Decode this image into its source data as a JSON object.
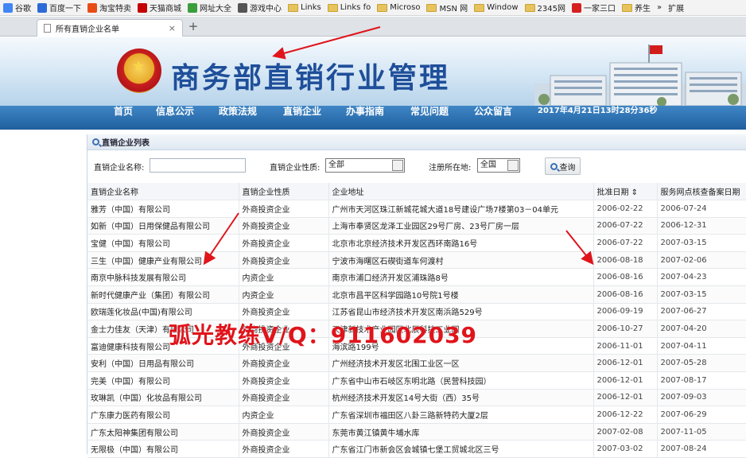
{
  "bookmarks": [
    {
      "label": "谷歌",
      "icon": "google-icon",
      "color": "#4285f4"
    },
    {
      "label": "百度一下",
      "icon": "baidu-icon",
      "color": "#2d6ad8"
    },
    {
      "label": "淘宝特卖",
      "icon": "taobao-icon",
      "color": "#e84c16"
    },
    {
      "label": "天猫商城",
      "icon": "tmall-icon",
      "color": "#c40000"
    },
    {
      "label": "网址大全",
      "icon": "globe-icon",
      "color": "#3a9e3a"
    },
    {
      "label": "游戏中心",
      "icon": "gamepad-icon",
      "color": "#555555"
    },
    {
      "label": "Links",
      "icon": "folder-icon"
    },
    {
      "label": "Links fo",
      "icon": "folder-icon"
    },
    {
      "label": "Microso",
      "icon": "folder-icon"
    },
    {
      "label": "MSN 网",
      "icon": "folder-icon"
    },
    {
      "label": "Window",
      "icon": "folder-icon"
    },
    {
      "label": "2345网",
      "icon": "folder-icon"
    },
    {
      "label": "一家三口",
      "icon": "jia-icon",
      "color": "#d62020"
    },
    {
      "label": "养生",
      "icon": "folder-icon"
    }
  ],
  "bookmarks_more": "»",
  "extension_label": "扩展",
  "tab": {
    "title": "所有直销企业名单",
    "close": "×",
    "new_tab": "+"
  },
  "site": {
    "title": "商务部直销行业管理"
  },
  "nav": {
    "items": [
      "首页",
      "信息公示",
      "政策法规",
      "直销企业",
      "办事指南",
      "常见问题",
      "公众留言"
    ],
    "date": "2017年4月21日13时28分36秒"
  },
  "panel": {
    "title": "直销企业列表"
  },
  "filters": {
    "name_label": "直销企业名称:",
    "type_label": "直销企业性质:",
    "type_value": "全部",
    "region_label": "注册所在地:",
    "region_value": "全国",
    "query_button": "查询"
  },
  "table": {
    "columns": [
      "直销企业名称",
      "直销企业性质",
      "企业地址",
      "批准日期 ⇕",
      "服务网点核查备案日期"
    ],
    "rows": [
      [
        "雅芳（中国）有限公司",
        "外商投资企业",
        "广州市天河区珠江新城花城大道18号建设广场7楼第03－04单元",
        "2006-02-22",
        "2006-07-24"
      ],
      [
        "如新（中国）日用保健品有限公司",
        "外商投资企业",
        "上海市奉贤区龙泽工业园区29号厂房、23号厂房一层",
        "2006-07-22",
        "2006-12-31"
      ],
      [
        "宝健（中国）有限公司",
        "外商投资企业",
        "北京市北京经济技术开发区西环南路16号",
        "2006-07-22",
        "2007-03-15"
      ],
      [
        "三生（中国）健康产业有限公司",
        "外商投资企业",
        "宁波市海曙区石碶街道车何渡村",
        "2006-08-18",
        "2007-02-06"
      ],
      [
        "南京中脉科技发展有限公司",
        "内资企业",
        "南京市浦口经济开发区浦珠路8号",
        "2006-08-16",
        "2007-04-23"
      ],
      [
        "新时代健康产业（集团）有限公司",
        "内资企业",
        "北京市昌平区科学园路10号院1号楼",
        "2006-08-16",
        "2007-03-15"
      ],
      [
        "欧瑞莲化妆品(中国)有限公司",
        "外商投资企业",
        "江苏省昆山市经济技术开发区南浜路529号",
        "2006-09-19",
        "2007-06-27"
      ],
      [
        "金士力佳友（天津）有限公司",
        "外商投资企业",
        "天津新技术产业园区北辰科技工业园",
        "2006-10-27",
        "2007-04-20"
      ],
      [
        "富迪健康科技有限公司",
        "外商投资企业",
        "海滨路199号",
        "2006-11-01",
        "2007-04-11"
      ],
      [
        "安利（中国）日用品有限公司",
        "外商投资企业",
        "广州经济技术开发区北围工业区一区",
        "2006-12-01",
        "2007-05-28"
      ],
      [
        "完美（中国）有限公司",
        "外商投资企业",
        "广东省中山市石岐区东明北路（民营科技园）",
        "2006-12-01",
        "2007-08-17"
      ],
      [
        "玫琳凯（中国）化妆品有限公司",
        "外商投资企业",
        "杭州经济技术开发区14号大街（西）35号",
        "2006-12-01",
        "2007-09-03"
      ],
      [
        "广东康力医药有限公司",
        "内资企业",
        "广东省深圳市福田区八卦三路新特药大厦2层",
        "2006-12-22",
        "2007-06-29"
      ],
      [
        "广东太阳神集团有限公司",
        "外商投资企业",
        "东莞市黄江镇黄牛埔水库",
        "2007-02-08",
        "2007-11-05"
      ],
      [
        "无限极（中国）有限公司",
        "外商投资企业",
        "广东省江门市新会区会城镇七堡工贸城北区三号",
        "2007-03-02",
        "2007-08-24"
      ]
    ]
  },
  "watermark": "弧光教练V/Q：911602039",
  "colors": {
    "nav": "#1f5f9e",
    "title": "#1f4f9a",
    "watermark": "#e0141b",
    "arrow": "#e0141b"
  }
}
